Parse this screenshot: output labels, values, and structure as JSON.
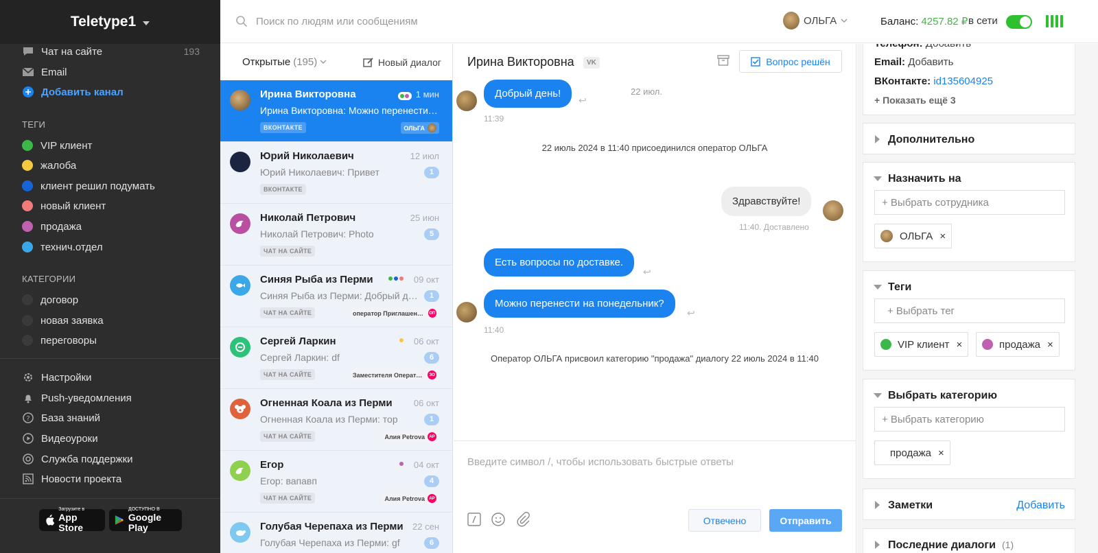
{
  "app": {
    "workspace": "Teletype1"
  },
  "sidebar": {
    "channels": [
      {
        "label": "Чат на сайте",
        "count": "193",
        "icon": "chat-bubble-icon"
      },
      {
        "label": "Email",
        "icon": "envelope-icon"
      },
      {
        "label": "Добавить канал",
        "icon": "plus-circle-icon"
      }
    ],
    "tags_title": "ТЕГИ",
    "tags": [
      {
        "label": "VIP клиент",
        "color": "#3cb84a"
      },
      {
        "label": "жалоба",
        "color": "#f5c842"
      },
      {
        "label": "клиент решил подумать",
        "color": "#1565d8"
      },
      {
        "label": "новый клиент",
        "color": "#f27a7a"
      },
      {
        "label": "продажа",
        "color": "#c060b0"
      },
      {
        "label": "технич.отдел",
        "color": "#3aa8e8"
      }
    ],
    "categories_title": "КАТЕГОРИИ",
    "categories": [
      {
        "label": "договор"
      },
      {
        "label": "новая заявка"
      },
      {
        "label": "переговоры"
      }
    ],
    "bottom": [
      {
        "label": "Настройки",
        "icon": "gear-icon"
      },
      {
        "label": "Push-уведомления",
        "icon": "bell-icon"
      },
      {
        "label": "База знаний",
        "icon": "question-icon"
      },
      {
        "label": "Видеоуроки",
        "icon": "play-icon"
      },
      {
        "label": "Служба поддержки",
        "icon": "lifebuoy-icon"
      },
      {
        "label": "Новости проекта",
        "icon": "rss-icon"
      }
    ],
    "appstore": {
      "small": "Загрузите в",
      "big": "App Store"
    },
    "googleplay": {
      "small": "ДОСТУПНО В",
      "big": "Google Play"
    }
  },
  "topbar": {
    "search_placeholder": "Поиск по людям или сообщениям",
    "operator": "ОЛЬГА",
    "balance_label": "Баланс:",
    "balance_value": "4257.82 ₽",
    "status_label": "в сети"
  },
  "list": {
    "filter_label": "Открытые",
    "filter_count": "(195)",
    "new_dialog": "Новый диалог",
    "items": [
      {
        "name": "Ирина Викторовна",
        "date": "1 мин",
        "preview": "Ирина Викторовна: Можно перенести на понедельник?",
        "channel": "ВКОНТАКТЕ",
        "operator": "ОЛЬГА",
        "avatar_color": "#8a6a3a"
      },
      {
        "name": "Юрий Николаевич",
        "date": "12 июл",
        "preview": "Юрий Николаевич: Привет",
        "channel": "ВКОНТАКТЕ",
        "badge": "1",
        "avatar_color": "#1c2540"
      },
      {
        "name": "Николай Петрович",
        "date": "25 июн",
        "preview": "Николай Петрович: Photo",
        "channel": "ЧАТ НА САЙТЕ",
        "badge": "5",
        "avatar_color": "#b84fa0"
      },
      {
        "name": "Синяя Рыба из Перми",
        "date": "09 окт",
        "preview": "Синяя Рыба из Перми: Добрый день",
        "channel": "ЧАТ НА САЙТЕ",
        "badge": "1",
        "operator": "оператор Приглашенный",
        "op_initials": "ОП",
        "avatar_color": "#3aa8e8",
        "tag_colors": [
          "#3cb84a",
          "#1565d8",
          "#f27a7a"
        ]
      },
      {
        "name": "Сергей Ларкин",
        "date": "06 окт",
        "preview": "Сергей Ларкин: df",
        "channel": "ЧАТ НА САЙТЕ",
        "badge": "6",
        "operator": "Заместителя Оператора",
        "op_initials": "ЗО",
        "avatar_color": "#2cc27a",
        "tag_colors": [
          "#f5c842"
        ]
      },
      {
        "name": "Огненная Коала из Перми",
        "date": "06 окт",
        "preview": "Огненная Коала из Перми: тор",
        "channel": "ЧАТ НА САЙТЕ",
        "badge": "1",
        "operator": "Алия Petrova",
        "op_initials": "АР",
        "avatar_color": "#e0623c"
      },
      {
        "name": "Егор",
        "date": "04 окт",
        "preview": "Егор: вапавп",
        "channel": "ЧАТ НА САЙТЕ",
        "badge": "4",
        "operator": "Алия Petrova",
        "op_initials": "АР",
        "avatar_color": "#8fd14f",
        "tag_colors": [
          "#c060b0"
        ]
      },
      {
        "name": "Голубая Черепаха из Перми",
        "date": "22 сен",
        "preview": "Голубая Черепаха из Перми: gf",
        "channel": "ЧАТ НА САЙТЕ",
        "badge": "6",
        "avatar_color": "#7fc8f0"
      }
    ]
  },
  "chat": {
    "name": "Ирина Викторовна",
    "channel_tag": "VK",
    "resolve_label": "Вопрос решён",
    "messages": {
      "m1": "Добрый день!",
      "m1_time": "11:39",
      "m1_date": "22 июл.",
      "sys1": "22 июль 2024 в 11:40 присоединился оператор ОЛЬГА",
      "m2": "Здравствуйте!",
      "m2_status": "11:40. Доставлено",
      "m3": "Есть вопросы по доставке.",
      "m4": "Можно перенести на понедельник?",
      "m4_time": "11:40",
      "sys2": "Оператор ОЛЬГА присвоил категорию \"продажа\" диалогу 22 июль 2024 в 11:40"
    },
    "composer_placeholder": "Введите символ /, чтобы использовать быстрые ответы",
    "answered_label": "Отвечено",
    "send_label": "Отправить"
  },
  "right": {
    "phone_label": "Телефон:",
    "phone_value": "Добавить",
    "email_label": "Email:",
    "email_value": "Добавить",
    "vk_label": "ВКонтакте:",
    "vk_value": "id135604925",
    "show_more": "+ Показать ещё 3",
    "extra_title": "Дополнительно",
    "assign_title": "Назначить на",
    "assign_placeholder": "+ Выбрать сотрудника",
    "assigned": "ОЛЬГА",
    "tags_title": "Теги",
    "tags_placeholder": "+ Выбрать тег",
    "tag_chips": [
      {
        "label": "VIP клиент",
        "color": "#3cb84a"
      },
      {
        "label": "продажа",
        "color": "#c060b0"
      }
    ],
    "category_title": "Выбрать категорию",
    "category_placeholder": "+ Выбрать категорию",
    "category_chip": "продажа",
    "notes_title": "Заметки",
    "notes_add": "Добавить",
    "last_dialogs_title": "Последние диалоги",
    "last_dialogs_count": "(1)"
  }
}
